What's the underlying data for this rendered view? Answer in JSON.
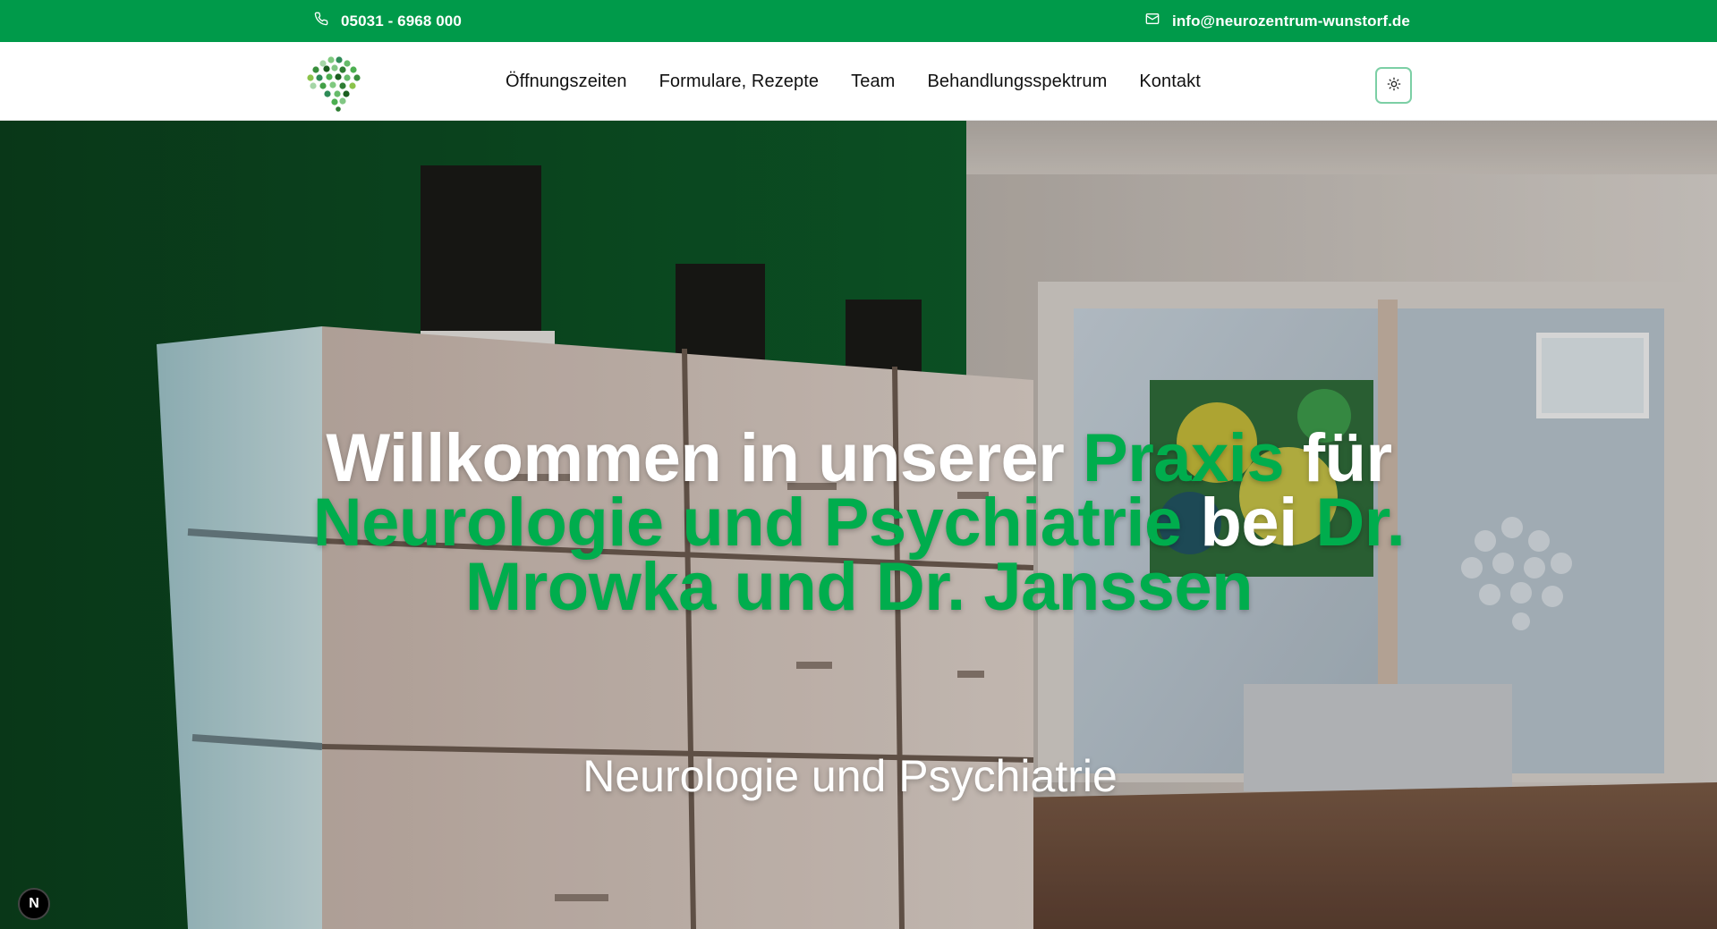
{
  "topbar": {
    "phone_icon": "phone-icon",
    "phone": "05031 - 6968 000",
    "mail_icon": "mail-icon",
    "email": "info@neurozentrum-wunstorf.de",
    "bg_color": "#009a4a"
  },
  "nav": {
    "logo_icon": "brain-dots-logo",
    "items": [
      {
        "label": "Öffnungszeiten"
      },
      {
        "label": "Formulare, Rezepte"
      },
      {
        "label": "Team"
      },
      {
        "label": "Behandlungsspektrum"
      },
      {
        "label": "Kontakt"
      }
    ],
    "theme_toggle_icon": "sun-icon"
  },
  "hero": {
    "title_parts": [
      {
        "text": "Willkommen in unserer ",
        "accent": false
      },
      {
        "text": "Praxis",
        "accent": true
      },
      {
        "text": " für ",
        "accent": false
      },
      {
        "text": "Neurologie und Psychiatrie",
        "accent": true
      },
      {
        "text": " bei ",
        "accent": false
      },
      {
        "text": "Dr. Mrowka und Dr. Janssen",
        "accent": true
      }
    ],
    "subtitle": "Neurologie und Psychiatrie",
    "accent_color": "#00ad4d"
  },
  "dev_badge": {
    "label": "N"
  }
}
